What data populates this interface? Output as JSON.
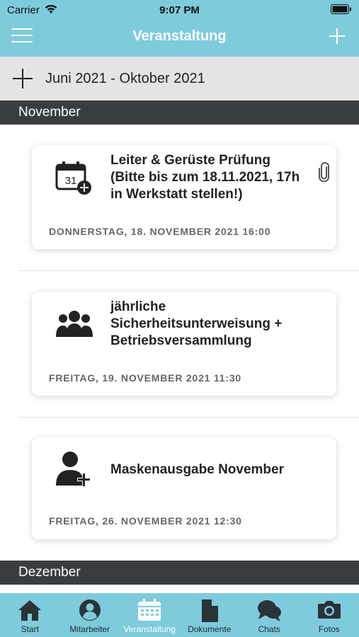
{
  "status": {
    "carrier": "Carrier",
    "time": "9:07 PM"
  },
  "nav": {
    "title": "Veranstaltung"
  },
  "range": {
    "label": "Juni 2021 - Oktober 2021"
  },
  "sections": [
    {
      "month": "November",
      "events": [
        {
          "icon": "calendar-add-icon",
          "calendar_day": "31",
          "title": "Leiter & Gerüste Prüfung (Bitte bis zum 18.11.2021, 17h in Werkstatt stellen!)",
          "date": "DONNERSTAG, 18. NOVEMBER 2021 16:00",
          "has_attachment": true
        },
        {
          "icon": "group-icon",
          "title": "jährliche Sicherheitsunterweisung + Betriebsversammlung",
          "date": "FREITAG, 19. NOVEMBER 2021 11:30",
          "has_attachment": false
        },
        {
          "icon": "user-add-icon",
          "title": "Maskenausgabe November",
          "date": "FREITAG, 26. NOVEMBER 2021 12:30",
          "has_attachment": false
        }
      ]
    },
    {
      "month": "Dezember",
      "events": []
    }
  ],
  "tabs": [
    {
      "label": "Start",
      "icon": "home-icon",
      "active": false
    },
    {
      "label": "Mitarbeiter",
      "icon": "person-icon",
      "active": false
    },
    {
      "label": "Veranstaltung",
      "icon": "calendar-icon",
      "active": true
    },
    {
      "label": "Dokumente",
      "icon": "document-icon",
      "active": false
    },
    {
      "label": "Chats",
      "icon": "chat-icon",
      "active": false
    },
    {
      "label": "Fotos",
      "icon": "camera-icon",
      "active": false
    }
  ],
  "colors": {
    "accent": "#7ecbdc",
    "section_header": "#3a3d40",
    "range_bg": "#e4e4e4"
  }
}
